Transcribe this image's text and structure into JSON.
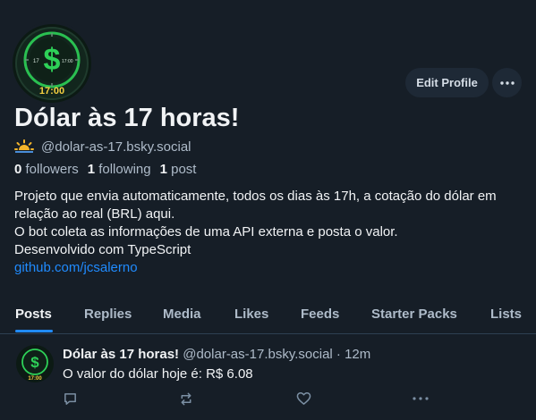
{
  "profile": {
    "display_name": "Dólar às 17 horas!",
    "handle": "@dolar-as-17.bsky.social",
    "followers_count": "0",
    "followers_label": "followers",
    "following_count": "1",
    "following_label": "following",
    "posts_count": "1",
    "posts_label": "post",
    "bio_lines": [
      "Projeto que envia automaticamente, todos os dias às 17h, a cotação do dólar em",
      "relação ao real (BRL) aqui.",
      "O bot coleta as informações de uma API externa e posta o valor.",
      "Desenvolvido com TypeScript"
    ],
    "bio_link": "github.com/jcsalerno",
    "avatar_clock_text": "17:00",
    "avatar_dial_left": "17",
    "avatar_dial_right": "17:00",
    "avatar_symbol": "$"
  },
  "actions": {
    "edit_profile_label": "Edit Profile",
    "more_icon": "ellipsis-icon"
  },
  "tabs": [
    {
      "label": "Posts",
      "active": true
    },
    {
      "label": "Replies",
      "active": false
    },
    {
      "label": "Media",
      "active": false
    },
    {
      "label": "Likes",
      "active": false
    },
    {
      "label": "Feeds",
      "active": false
    },
    {
      "label": "Starter Packs",
      "active": false
    },
    {
      "label": "Lists",
      "active": false
    }
  ],
  "post": {
    "author_name": "Dólar às 17 horas!",
    "author_handle": "@dolar-as-17.bsky.social",
    "separator": "·",
    "time": "12m",
    "text": "O valor do dólar hoje é: R$ 6.08"
  },
  "colors": {
    "background": "#161e27",
    "accent": "#208bfe",
    "secondary_text": "#aebbc9",
    "avatar_green": "#2ed158"
  }
}
